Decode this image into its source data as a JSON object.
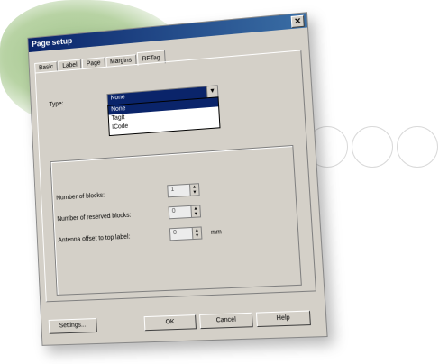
{
  "window": {
    "title": "Page setup",
    "close_glyph": "✕"
  },
  "tabs": [
    "Basic",
    "Label",
    "Page",
    "Margins",
    "RFTag"
  ],
  "active_tab_index": 4,
  "type": {
    "label": "Type:",
    "selected": "None",
    "options": [
      "None",
      "TagIt",
      "ICode"
    ]
  },
  "fields": {
    "blocks_label": "Number of blocks:",
    "blocks_value": "1",
    "reserved_label": "Number of reserved blocks:",
    "reserved_value": "0",
    "antenna_label": "Antenna offset to top label:",
    "antenna_value": "0",
    "antenna_unit": "mm"
  },
  "buttons": {
    "settings": "Settings...",
    "ok": "OK",
    "cancel": "Cancel",
    "help": "Help"
  },
  "colors": {
    "titlebar": "#0a246a",
    "dialog_face": "#d4d0c8",
    "accent_blob": "#9fc28a"
  }
}
